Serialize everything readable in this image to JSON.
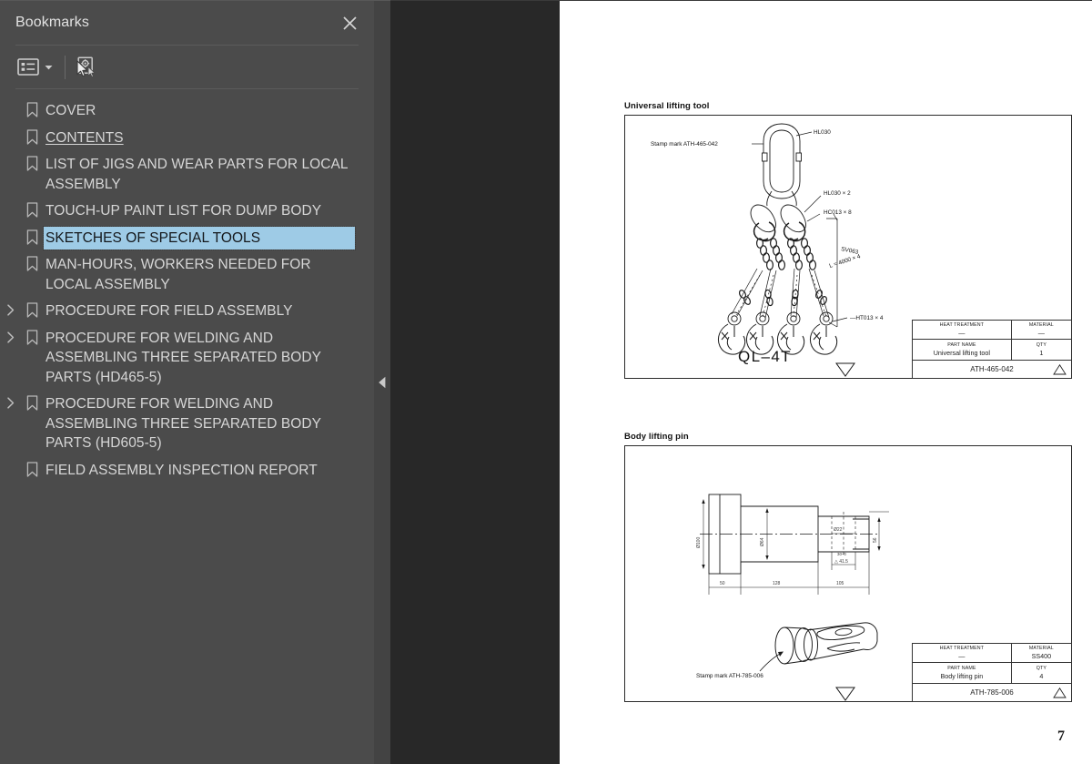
{
  "sidebar": {
    "title": "Bookmarks",
    "close_icon": "close-icon",
    "toolbar": {
      "list_options_label": "Bookmark list options",
      "list_icon": "list-view-icon",
      "caret_icon": "chevron-down-icon",
      "expand_current_label": "Expand current bookmark",
      "expand_current_icon": "expand-current-bookmark-icon"
    },
    "bookmarks": [
      {
        "label": "COVER",
        "expandable": false,
        "selected": false,
        "underlined": false
      },
      {
        "label": "CONTENTS",
        "expandable": false,
        "selected": false,
        "underlined": true
      },
      {
        "label": "LIST OF JIGS AND WEAR PARTS FOR LOCAL ASSEMBLY",
        "expandable": false,
        "selected": false,
        "underlined": false
      },
      {
        "label": "TOUCH-UP PAINT LIST FOR DUMP BODY",
        "expandable": false,
        "selected": false,
        "underlined": false
      },
      {
        "label": "SKETCHES OF SPECIAL TOOLS",
        "expandable": false,
        "selected": true,
        "underlined": false
      },
      {
        "label": "MAN-HOURS, WORKERS NEEDED FOR LOCAL ASSEMBLY",
        "expandable": false,
        "selected": false,
        "underlined": false
      },
      {
        "label": "PROCEDURE FOR FIELD ASSEMBLY",
        "expandable": true,
        "selected": false,
        "underlined": false
      },
      {
        "label": "PROCEDURE FOR WELDING AND ASSEMBLING THREE SEPARATED BODY PARTS (HD465-5)",
        "expandable": true,
        "selected": false,
        "underlined": false
      },
      {
        "label": "PROCEDURE FOR WELDING AND ASSEMBLING THREE SEPARATED BODY PARTS (HD605-5)",
        "expandable": true,
        "selected": false,
        "underlined": false
      },
      {
        "label": "FIELD ASSEMBLY INSPECTION REPORT",
        "expandable": false,
        "selected": false,
        "underlined": false
      }
    ]
  },
  "collapse_handle": {
    "icon": "chevron-left-icon",
    "label": "Collapse panel"
  },
  "document": {
    "page_number": "7",
    "figures": [
      {
        "caption": "Universal lifting tool",
        "model_designation": "QL-4T",
        "annotations": [
          {
            "text": "Stamp mark  ATH-465-042"
          },
          {
            "text": "HL030"
          },
          {
            "text": "HL030 × 2"
          },
          {
            "text": "HC013 × 8"
          },
          {
            "text": "SV063"
          },
          {
            "text": "L = 4000 × 4"
          },
          {
            "text": "HT013 × 4"
          }
        ],
        "title_block": {
          "heat_treatment_label": "HEAT TREATMENT",
          "heat_treatment_value": "—",
          "material_label": "MATERIAL",
          "material_value": "—",
          "part_name_label": "PART NAME",
          "part_name_value": "Universal lifting tool",
          "qty_label": "QTY",
          "qty_value": "1",
          "drawing_number": "ATH-465-042"
        }
      },
      {
        "caption": "Body lifting pin",
        "annotations": [
          {
            "text": "Stamp mark  ATH-785-006"
          }
        ],
        "title_block": {
          "heat_treatment_label": "HEAT TREATMENT",
          "heat_treatment_value": "—",
          "material_label": "MATERIAL",
          "material_value": "SS400",
          "part_name_label": "PART NAME",
          "part_name_value": "Body lifting pin",
          "qty_label": "QTY",
          "qty_value": "4",
          "drawing_number": "ATH-785-006"
        }
      }
    ]
  },
  "colors": {
    "sidebar_bg": "#4b4b4b",
    "doc_bg": "#282828",
    "page_bg": "#ffffff",
    "selection": "#9ecbe6",
    "text": "#d6d6d6"
  }
}
